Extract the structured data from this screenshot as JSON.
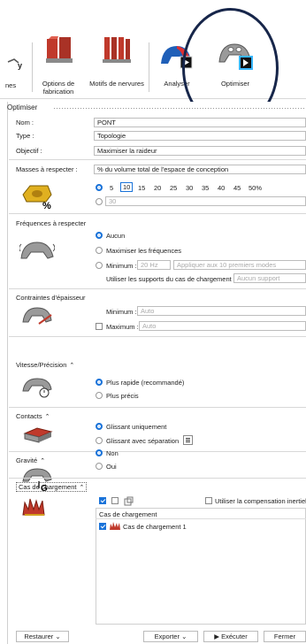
{
  "ribbon": {
    "items": [
      {
        "label1": "nes",
        "label2": ""
      },
      {
        "label1": "Options de",
        "label2": "fabrication"
      },
      {
        "label1": "Motifs de nervures",
        "label2": ""
      },
      {
        "label1": "Analyser",
        "label2": ""
      },
      {
        "label1": "Optimiser",
        "label2": ""
      }
    ],
    "partial_glyph": "y"
  },
  "panel": {
    "title": "Optimiser",
    "nom_label": "Nom :",
    "nom_value": "PONT",
    "type_label": "Type :",
    "type_value": "Topologie",
    "objectif_label": "Objectif :",
    "objectif_value": "Maximiser la raideur",
    "masses_label": "Masses à respecter :",
    "masses_value": "% du volume total de l'espace de conception",
    "mass_percents": [
      "5",
      "10",
      "15",
      "20",
      "25",
      "30",
      "35",
      "40",
      "45",
      "50%"
    ],
    "mass_custom_value": "30",
    "freq_title": "Fréquences à respecter",
    "freq_opt1": "Aucun",
    "freq_opt2": "Maximiser les fréquences",
    "freq_opt3": "Minimum :",
    "freq_min_value": "20 Hz",
    "freq_modes_value": "Appliquer aux 10 premiers modes",
    "freq_support_label": "Utiliser les supports du cas de chargement :",
    "freq_support_value": "Aucun support",
    "thick_title": "Contraintes d'épaisseur",
    "thick_min_label": "Minimum :",
    "thick_min_value": "Auto",
    "thick_max_label": "Maximum :",
    "thick_max_value": "Auto",
    "speed_title": "Vitesse/Précision",
    "speed_opt1": "Plus rapide (recommandé)",
    "speed_opt2": "Plus précis",
    "contacts_title": "Contacts",
    "contacts_opt1": "Glissant uniquement",
    "contacts_opt2": "Glissant avec séparation",
    "gravity_title": "Gravité",
    "gravity_opt1": "Non",
    "gravity_opt2": "Oui",
    "load_title": "Cas de chargement",
    "inertia_label": "Utiliser la compensation inertielle",
    "load_header": "Cas de chargement",
    "load_item": "Cas de chargement 1",
    "chevron": "⌃"
  },
  "footer": {
    "restore": "Restaurer",
    "export": "Exporter",
    "run": "Exécuter",
    "close": "Fermer"
  },
  "colors": {
    "accent": "#1a73d9",
    "ring": "#17264a"
  }
}
